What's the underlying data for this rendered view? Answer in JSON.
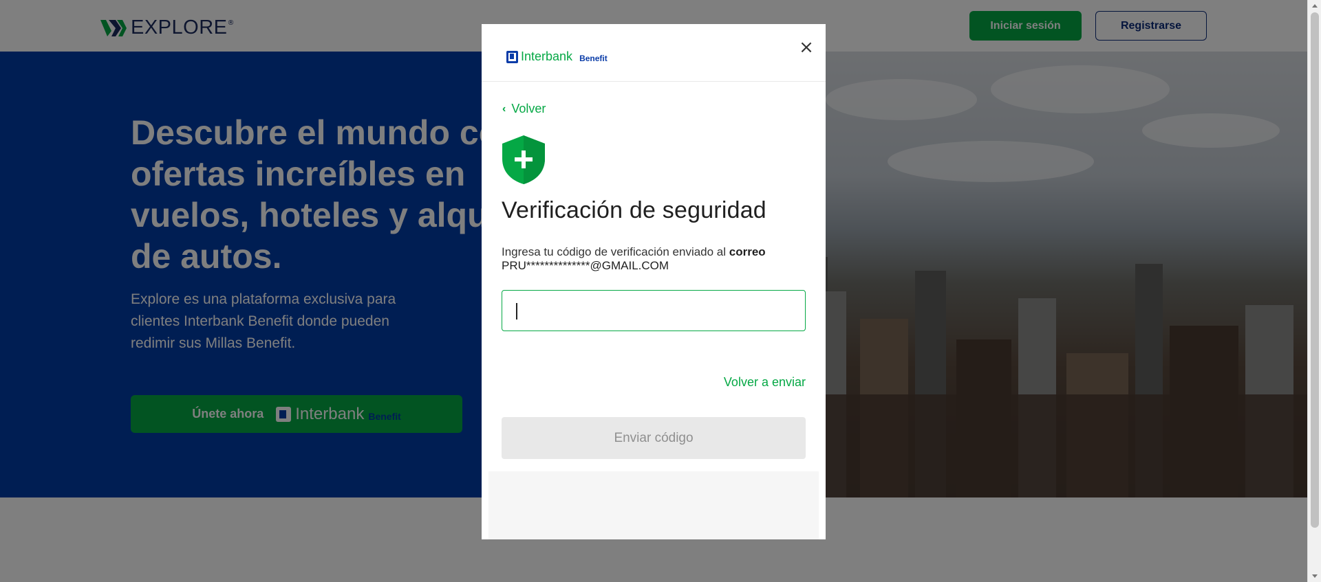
{
  "header": {
    "brand_name": "EXPLORE",
    "login_label": "Iniciar sesión",
    "register_label": "Registrarse"
  },
  "hero": {
    "title": "Descubre el mundo con ofertas increíbles en vuelos, hoteles y alquiler de autos.",
    "subtitle": "Explore es una plataforma exclusiva para clientes Interbank Benefit donde pueden redimir sus Millas Benefit.",
    "join_label": "Únete ahora",
    "join_brand": "Interbank",
    "join_brand_sub": "Benefit"
  },
  "modal": {
    "logo_word": "Interbank",
    "logo_sub": "Benefit",
    "close_symbol": "×",
    "back_label": "Volver",
    "heading": "Verificación de seguridad",
    "instruction_prefix": "Ingresa tu código de verificación enviado al ",
    "instruction_channel": "correo",
    "email": "PRU**************@GMAIL.COM",
    "code_value": "",
    "resend_label": "Volver a enviar",
    "submit_label": "Enviar código"
  },
  "colors": {
    "primary_green": "#05a845",
    "brand_blue": "#003ca6",
    "disabled_bg": "#e8e8e8",
    "disabled_text": "#8f8f8f"
  }
}
